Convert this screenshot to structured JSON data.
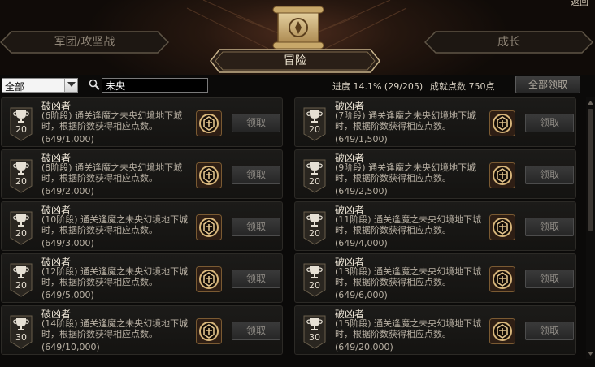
{
  "header": {
    "back_label": "返回",
    "tabs": [
      {
        "label": "军团/攻坚战"
      },
      {
        "label": "冒险",
        "active": true
      },
      {
        "label": "成长"
      }
    ]
  },
  "toolbar": {
    "filter": {
      "selected": "全部"
    },
    "search": {
      "value": "未央"
    },
    "progress_label": "进度 14.1% (29/205)",
    "points_label": "成就点数 750点",
    "claim_all_label": "全部领取"
  },
  "achievements": [
    {
      "title": "破凶者",
      "desc": "(6阶段) 通关逢魔之未央幻境地下城时，根据阶数获得相应点数。",
      "progress": "(649/1,000)",
      "points": "20",
      "button": "领取"
    },
    {
      "title": "破凶者",
      "desc": "(7阶段) 通关逢魔之未央幻境地下城时，根据阶数获得相应点数。",
      "progress": "(649/1,500)",
      "points": "20",
      "button": "领取"
    },
    {
      "title": "破凶者",
      "desc": "(8阶段) 通关逢魔之未央幻境地下城时，根据阶数获得相应点数。",
      "progress": "(649/2,000)",
      "points": "20",
      "button": "领取"
    },
    {
      "title": "破凶者",
      "desc": "(9阶段) 通关逢魔之未央幻境地下城时，根据阶数获得相应点数。",
      "progress": "(649/2,500)",
      "points": "20",
      "button": "领取"
    },
    {
      "title": "破凶者",
      "desc": "(10阶段) 通关逢魔之未央幻境地下城时，根据阶数获得相应点数。",
      "progress": "(649/3,000)",
      "points": "20",
      "button": "领取"
    },
    {
      "title": "破凶者",
      "desc": "(11阶段) 通关逢魔之未央幻境地下城时，根据阶数获得相应点数。",
      "progress": "(649/4,000)",
      "points": "20",
      "button": "领取"
    },
    {
      "title": "破凶者",
      "desc": "(12阶段) 通关逢魔之未央幻境地下城时，根据阶数获得相应点数。",
      "progress": "(649/5,000)",
      "points": "20",
      "button": "领取"
    },
    {
      "title": "破凶者",
      "desc": "(13阶段) 通关逢魔之未央幻境地下城时，根据阶数获得相应点数。",
      "progress": "(649/6,000)",
      "points": "20",
      "button": "领取"
    },
    {
      "title": "破凶者",
      "desc": "(14阶段) 通关逢魔之未央幻境地下城时，根据阶数获得相应点数。",
      "progress": "(649/10,000)",
      "points": "30",
      "button": "领取"
    },
    {
      "title": "破凶者",
      "desc": "(15阶段) 通关逢魔之未央幻境地下城时，根据阶数获得相应点数。",
      "progress": "(649/20,000)",
      "points": "30",
      "button": "领取"
    }
  ],
  "colors": {
    "accent_gold": "#c9a45a",
    "panel": "#1a1917",
    "header_glow": "#4a2a1c"
  }
}
